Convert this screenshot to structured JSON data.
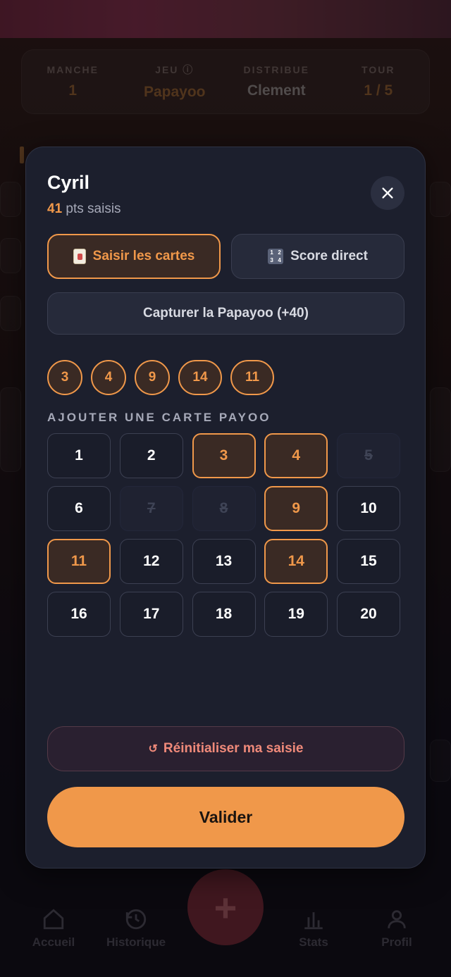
{
  "game_info": [
    {
      "label": "MANCHE",
      "value": "1",
      "tone": "orange"
    },
    {
      "label": "JEU ⓘ",
      "value": "Papayoo",
      "tone": "orange"
    },
    {
      "label": "DISTRIBUE",
      "value": "Clement",
      "tone": "grey"
    },
    {
      "label": "TOUR",
      "value": "1 / 5",
      "tone": "orange"
    }
  ],
  "modal": {
    "player_name": "Cyril",
    "points": "41",
    "points_suffix": " pts saisis",
    "close_icon": "close-icon",
    "mode_cards_label": "Saisir les cartes",
    "mode_direct_label": "Score direct",
    "capture_label": "Capturer la Papayoo (+40)",
    "selected_chips": [
      "3",
      "4",
      "9",
      "14",
      "11"
    ],
    "section_title": "AJOUTER UNE CARTE PAYOO",
    "cards": [
      {
        "n": "1",
        "state": "normal"
      },
      {
        "n": "2",
        "state": "normal"
      },
      {
        "n": "3",
        "state": "selected"
      },
      {
        "n": "4",
        "state": "selected"
      },
      {
        "n": "5",
        "state": "disabled"
      },
      {
        "n": "6",
        "state": "normal"
      },
      {
        "n": "7",
        "state": "disabled"
      },
      {
        "n": "8",
        "state": "disabled"
      },
      {
        "n": "9",
        "state": "selected"
      },
      {
        "n": "10",
        "state": "normal"
      },
      {
        "n": "11",
        "state": "selected"
      },
      {
        "n": "12",
        "state": "normal"
      },
      {
        "n": "13",
        "state": "normal"
      },
      {
        "n": "14",
        "state": "selected"
      },
      {
        "n": "15",
        "state": "normal"
      },
      {
        "n": "16",
        "state": "normal"
      },
      {
        "n": "17",
        "state": "normal"
      },
      {
        "n": "18",
        "state": "normal"
      },
      {
        "n": "19",
        "state": "normal"
      },
      {
        "n": "20",
        "state": "normal"
      }
    ],
    "reset_icon": "↺",
    "reset_label": "Réinitialiser ma saisie",
    "submit_label": "Valider"
  },
  "nav": [
    {
      "label": "Accueil",
      "icon": "home-icon"
    },
    {
      "label": "Historique",
      "icon": "history-icon"
    },
    {
      "label": "Stats",
      "icon": "stats-icon"
    },
    {
      "label": "Profil",
      "icon": "profile-icon"
    }
  ],
  "fab_label": "+",
  "colors": {
    "accent": "#f0984a",
    "modal_bg": "#1c1f2d",
    "reset_text": "#f08a7a"
  }
}
